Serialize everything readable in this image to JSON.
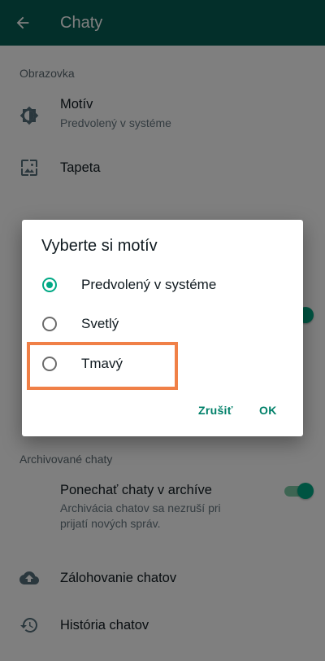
{
  "app_bar": {
    "title": "Chaty"
  },
  "display_section": {
    "header": "Obrazovka",
    "theme": {
      "title": "Motív",
      "subtitle": "Predvolený v systéme"
    },
    "wallpaper": {
      "title": "Tapeta"
    }
  },
  "archived_section": {
    "header": "Archivované chaty",
    "keep_archived": {
      "title": "Ponechať chaty v archíve",
      "subtitle_line1": "Archivácia chatov sa nezruší pri",
      "subtitle_line2": "prijatí nových správ.",
      "enabled": true
    }
  },
  "backup": {
    "title": "Zálohovanie chatov"
  },
  "history": {
    "title": "História chatov"
  },
  "dialog": {
    "title": "Vyberte si motív",
    "options": [
      {
        "label": "Predvolený v systéme",
        "selected": true
      },
      {
        "label": "Svetlý",
        "selected": false
      },
      {
        "label": "Tmavý",
        "selected": false
      }
    ],
    "cancel_label": "Zrušiť",
    "ok_label": "OK"
  },
  "colors": {
    "app_bar": "#075E54",
    "accent": "#00A884",
    "highlight": "#F08047"
  }
}
